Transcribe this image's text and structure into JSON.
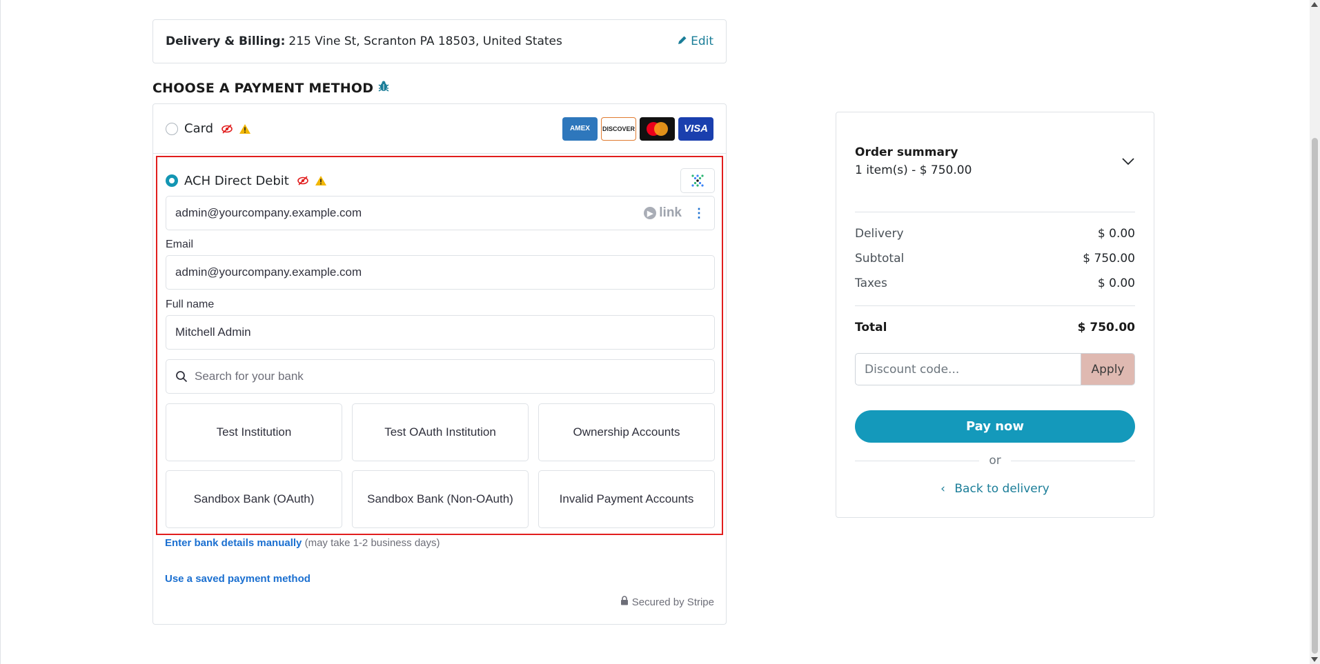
{
  "delivery": {
    "label": "Delivery & Billing:",
    "address": "215 Vine St, Scranton PA 18503, United States",
    "edit_label": "Edit"
  },
  "payment": {
    "section_title": "CHOOSE A PAYMENT METHOD",
    "card_label": "Card",
    "ach_label": "ACH Direct Debit",
    "brands": [
      "AMEX",
      "DISCOVER",
      "mastercard",
      "VISA"
    ],
    "link_email_value": "admin@yourcompany.example.com",
    "link_tag": "link",
    "email_label": "Email",
    "email_value": "admin@yourcompany.example.com",
    "fullname_label": "Full name",
    "fullname_value": "Mitchell Admin",
    "bank_search_placeholder": "Search for your bank",
    "banks": [
      "Test Institution",
      "Test OAuth Institution",
      "Ownership Accounts",
      "Sandbox Bank (OAuth)",
      "Sandbox Bank (Non-OAuth)",
      "Invalid Payment Accounts"
    ],
    "manual_link": "Enter bank details manually",
    "manual_note": "(may take 1-2 business days)",
    "saved_link": "Use a saved payment method",
    "secured": "Secured by Stripe"
  },
  "summary": {
    "title": "Order summary",
    "subtitle": "1 item(s) -  $ 750.00",
    "rows": [
      {
        "label": "Delivery",
        "value": "$ 0.00"
      },
      {
        "label": "Subtotal",
        "value": "$ 750.00"
      },
      {
        "label": "Taxes",
        "value": "$ 0.00"
      }
    ],
    "total_label": "Total",
    "total_value": "$ 750.00",
    "discount_placeholder": "Discount code...",
    "apply_label": "Apply",
    "pay_label": "Pay now",
    "or_label": "or",
    "back_label": "Back to delivery"
  },
  "colors": {
    "accent": "#1499bb",
    "highlight_border": "#e11d1d",
    "link": "#1a6fd0",
    "apply_bg": "#dfb9b1"
  }
}
